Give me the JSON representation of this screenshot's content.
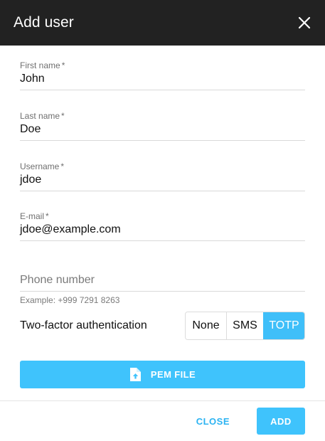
{
  "dialog": {
    "title": "Add user",
    "close_icon": "close-icon"
  },
  "form": {
    "first_name": {
      "label": "First name",
      "required_mark": "*",
      "value": "John"
    },
    "last_name": {
      "label": "Last name",
      "required_mark": "*",
      "value": "Doe"
    },
    "username": {
      "label": "Username",
      "required_mark": "*",
      "value": "jdoe"
    },
    "email": {
      "label": "E-mail",
      "required_mark": "*",
      "value": "jdoe@example.com"
    },
    "phone": {
      "placeholder": "Phone number",
      "value": "",
      "hint": "Example: +999 7291 8263"
    },
    "two_factor": {
      "label": "Two-factor authentication",
      "options": [
        "None",
        "SMS",
        "TOTP"
      ],
      "selected": "TOTP"
    },
    "pem_button": {
      "label": "PEM FILE",
      "icon": "file-upload-icon"
    }
  },
  "footer": {
    "close_label": "CLOSE",
    "add_label": "ADD"
  },
  "colors": {
    "header_bg": "#222222",
    "accent": "#3fc3fc",
    "accent_text": "#2bb3f2"
  }
}
